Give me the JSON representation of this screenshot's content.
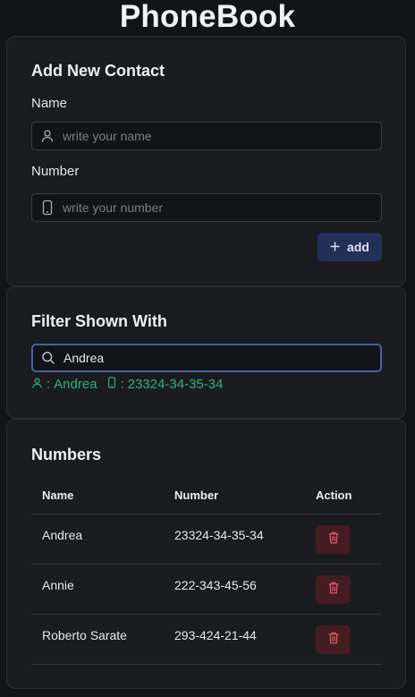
{
  "app": {
    "title": "PhoneBook"
  },
  "add_contact": {
    "heading": "Add New Contact",
    "name_label": "Name",
    "name_placeholder": "write your name",
    "name_value": "",
    "number_label": "Number",
    "number_placeholder": "write your number",
    "number_value": "",
    "add_label": "add",
    "add_icon": "plus-icon"
  },
  "filter": {
    "heading": "Filter Shown With",
    "value": "Andrea",
    "placeholder": "",
    "match": {
      "name": "Andrea",
      "number": "23324-34-35-34",
      "separator": ":"
    },
    "match_color": "#2fb37c"
  },
  "numbers": {
    "heading": "Numbers",
    "columns": [
      "Name",
      "Number",
      "Action"
    ],
    "rows": [
      {
        "name": "Andrea",
        "number": "23324-34-35-34"
      },
      {
        "name": "Annie",
        "number": "222-343-45-56"
      },
      {
        "name": "Roberto Sarate",
        "number": "293-424-21-44"
      }
    ],
    "delete_icon": "trash-icon"
  },
  "colors": {
    "background": "#131417",
    "card": "#1b1c20",
    "accent_button": "#233059",
    "focus_border": "#4a5fa8",
    "delete_button": "#451c22",
    "delete_icon": "#e2606a"
  }
}
